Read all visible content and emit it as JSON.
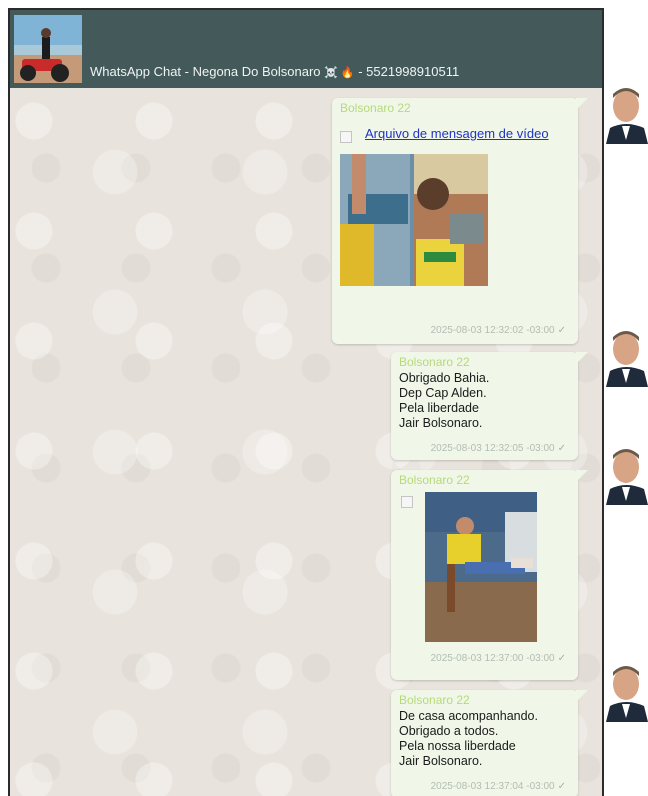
{
  "header": {
    "title": "WhatsApp Chat - Negona Do Bolsonaro",
    "title_icons": "☠️ 🔥",
    "phone": "- 5521998910511"
  },
  "messages": [
    {
      "sender": "Bolsonaro 22",
      "attachment_label": "Arquivo de mensagem de vídeo",
      "timestamp": "2025-08-03 12:32:02 -03:00"
    },
    {
      "sender": "Bolsonaro 22",
      "text": "Obrigado Bahia.\nDep Cap Alden.\nPela liberdade\nJair Bolsonaro.",
      "timestamp": "2025-08-03 12:32:05 -03:00"
    },
    {
      "sender": "Bolsonaro 22",
      "timestamp": "2025-08-03 12:37:00 -03:00"
    },
    {
      "sender": "Bolsonaro 22",
      "text": "De casa acompanhando.\nObrigado a todos.\nPela nossa liberdade\nJair Bolsonaro.",
      "timestamp": "2025-08-03 12:37:04 -03:00"
    }
  ],
  "icons": {
    "read_receipt": "check-icon",
    "attachment": "file-icon"
  },
  "colors": {
    "header_bg": "#445a5a",
    "bubble_bg": "#f0f7e8",
    "sender_name": "#b7d97c",
    "link": "#1f33c4"
  }
}
